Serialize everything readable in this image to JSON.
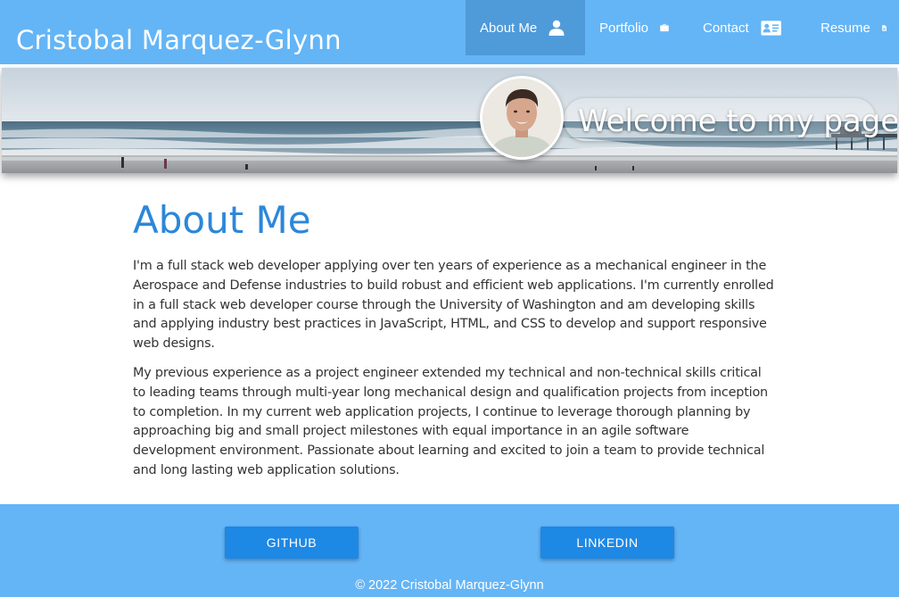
{
  "site": {
    "title": "Cristobal Marquez-Glynn"
  },
  "nav": {
    "items": [
      {
        "label": "About Me",
        "icon": "person-icon",
        "active": true
      },
      {
        "label": "Portfolio",
        "icon": "briefcase-icon",
        "active": false
      },
      {
        "label": "Contact",
        "icon": "contact-card-icon",
        "active": false
      },
      {
        "label": "Resume",
        "icon": "document-icon",
        "active": false
      }
    ]
  },
  "banner": {
    "welcome": "Welcome to my page!"
  },
  "main": {
    "heading": "About Me",
    "paragraphs": [
      "I'm a full stack web developer applying over ten years of experience as a mechanical engineer in the Aerospace and Defense industries to build robust and efficient web applications. I'm currently enrolled in a full stack web developer course through the University of Washington and am developing skills and applying industry best practices in JavaScript, HTML, and CSS to develop and support responsive web designs.",
      "My previous experience as a project engineer extended my technical and non-technical skills critical to leading teams through multi-year long mechanical design and qualification projects from inception to completion. In my current web application projects, I continue to leverage thorough planning by approaching big and small project milestones with equal importance in an agile software development environment. Passionate about learning and excited to join a team to provide technical and long lasting web application solutions."
    ]
  },
  "footer": {
    "github_label": "GITHUB",
    "linkedin_label": "LINKEDIN",
    "copyright": "© 2022 Cristobal Marquez-Glynn"
  },
  "colors": {
    "header_bg": "#64b5f6",
    "nav_active_bg": "#4f9ad9",
    "heading": "#2c87d9",
    "button": "#1e88e5"
  }
}
